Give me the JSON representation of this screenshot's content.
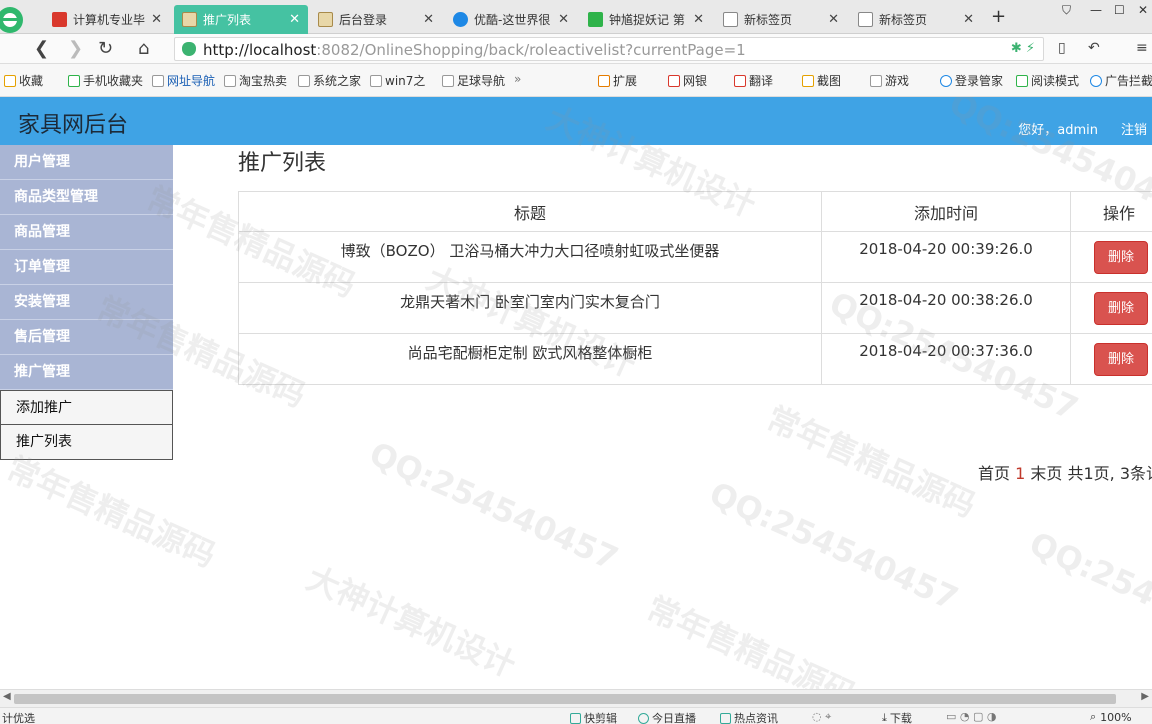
{
  "browser": {
    "tabs": [
      {
        "title": "计算机专业毕",
        "fav_color": "#d9382c"
      },
      {
        "title": "推广列表",
        "fav_color": "#c9a45a"
      },
      {
        "title": "后台登录",
        "fav_color": "#c9a45a"
      },
      {
        "title": "优酷-这世界很",
        "fav_color": "#1e88e5"
      },
      {
        "title": "钟馗捉妖记 第",
        "fav_color": "#2fb34a"
      },
      {
        "title": "新标签页",
        "fav_color": "#888888"
      },
      {
        "title": "新标签页",
        "fav_color": "#888888"
      }
    ],
    "url_host": "http://localhost",
    "url_rest": ":8082/OnlineShopping/back/roleactivelist?currentPage=1",
    "favorites": [
      {
        "label": "收藏"
      },
      {
        "label": "手机收藏夹"
      },
      {
        "label": "网址导航"
      },
      {
        "label": "淘宝热卖"
      },
      {
        "label": "系统之家"
      },
      {
        "label": "win7之"
      },
      {
        "label": "足球导航"
      },
      {
        "label": "扩展"
      },
      {
        "label": "网银"
      },
      {
        "label": "翻译"
      },
      {
        "label": "截图"
      },
      {
        "label": "游戏"
      },
      {
        "label": "登录管家"
      },
      {
        "label": "阅读模式"
      },
      {
        "label": "广告拦截"
      }
    ]
  },
  "header": {
    "brand": "家具网后台",
    "greeting": "您好，admin",
    "logout": "注销"
  },
  "sidebar": {
    "groups": [
      "用户管理",
      "商品类型管理",
      "商品管理",
      "订单管理",
      "安装管理",
      "售后管理",
      "推广管理"
    ],
    "subitems": [
      "添加推广",
      "推广列表"
    ]
  },
  "main": {
    "title": "推广列表",
    "columns": [
      "标题",
      "添加时间",
      "操作"
    ],
    "rows": [
      {
        "title": "博致（BOZO） 卫浴马桶大冲力大口径喷射虹吸式坐便器",
        "time": "2018-04-20 00:39:26.0",
        "action": "删除"
      },
      {
        "title": "龙鼎天著木门 卧室门室内门实木复合门",
        "time": "2018-04-20 00:38:26.0",
        "action": "删除"
      },
      {
        "title": "尚品宅配橱柜定制 欧式风格整体橱柜",
        "time": "2018-04-20 00:37:36.0",
        "action": "删除"
      }
    ],
    "pager": {
      "first": "首页",
      "current": "1",
      "last": "末页",
      "summary": "共1页, 3条记"
    }
  },
  "status": {
    "left": "计优选",
    "items": [
      "快剪辑",
      "今日直播",
      "热点资讯",
      "下载"
    ],
    "zoom": "100%"
  },
  "watermarks": [
    "常年售精品源码",
    "大神计算机设计",
    "QQ:254540457"
  ]
}
